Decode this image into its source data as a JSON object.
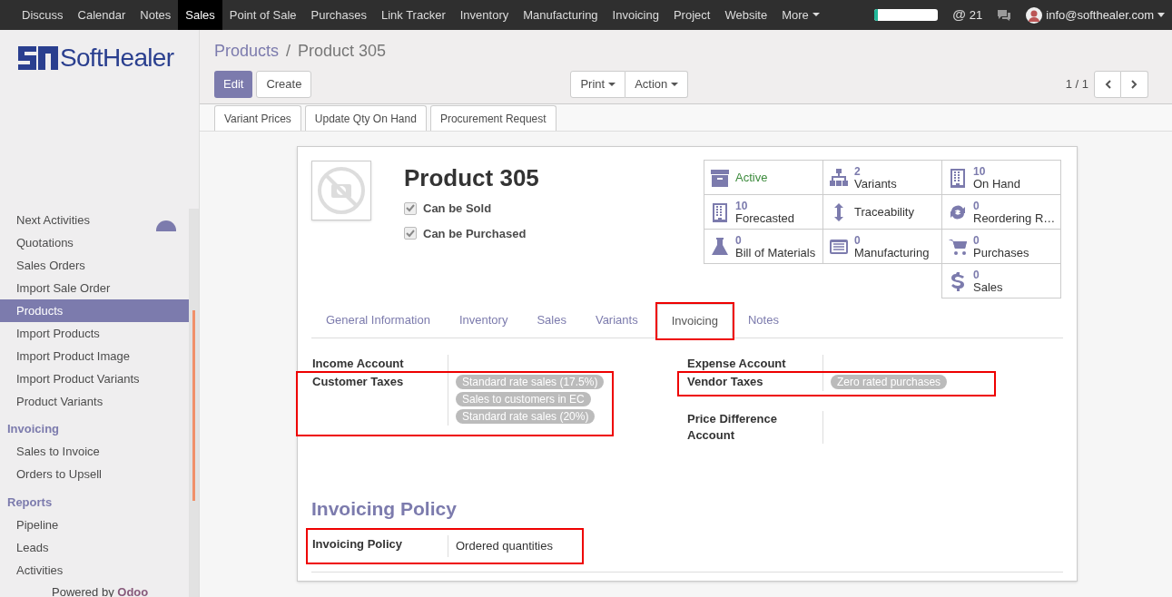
{
  "top_menu": [
    {
      "label": "Discuss",
      "selected": false
    },
    {
      "label": "Calendar",
      "selected": false
    },
    {
      "label": "Notes",
      "selected": false
    },
    {
      "label": "Sales",
      "selected": true
    },
    {
      "label": "Point of Sale",
      "selected": false
    },
    {
      "label": "Purchases",
      "selected": false
    },
    {
      "label": "Link Tracker",
      "selected": false
    },
    {
      "label": "Inventory",
      "selected": false
    },
    {
      "label": "Manufacturing",
      "selected": false
    },
    {
      "label": "Invoicing",
      "selected": false
    },
    {
      "label": "Project",
      "selected": false
    },
    {
      "label": "Website",
      "selected": false
    },
    {
      "label": "More",
      "selected": false
    }
  ],
  "systray": {
    "progress": {
      "level": 0.05
    },
    "at_sign": "@",
    "activity_count": "21",
    "user": "info@softhealer.com"
  },
  "sidebar": {
    "logo": "SoftHealer",
    "sections": [
      {
        "items": [
          {
            "label": "Next Activities",
            "selected": false
          },
          {
            "label": "Quotations",
            "selected": false
          },
          {
            "label": "Sales Orders",
            "selected": false
          },
          {
            "label": "Import Sale Order",
            "selected": false
          },
          {
            "label": "Products",
            "selected": true
          },
          {
            "label": "Import Products",
            "selected": false
          },
          {
            "label": "Import Product Image",
            "selected": false
          },
          {
            "label": "Import Product Variants",
            "selected": false
          },
          {
            "label": "Product Variants",
            "selected": false
          }
        ]
      },
      {
        "title": "Invoicing",
        "items": [
          {
            "label": "Sales to Invoice",
            "selected": false
          },
          {
            "label": "Orders to Upsell",
            "selected": false
          }
        ]
      },
      {
        "title": "Reports",
        "items": [
          {
            "label": "Pipeline",
            "selected": false
          },
          {
            "label": "Leads",
            "selected": false
          },
          {
            "label": "Activities",
            "selected": false
          }
        ]
      }
    ],
    "footer_prefix": "Powered by",
    "footer_brand": "Odoo"
  },
  "breadcrumb": {
    "parent": "Products",
    "separator": "/",
    "current": "Product 305"
  },
  "buttons": {
    "edit": "Edit",
    "create": "Create",
    "print": "Print",
    "action": "Action",
    "pager": "1 / 1"
  },
  "header_buttons": [
    "Variant Prices",
    "Update Qty On Hand",
    "Procurement Request"
  ],
  "product": {
    "name": "Product 305",
    "checkboxes": [
      {
        "label": "Can be Sold",
        "checked": true
      },
      {
        "label": "Can be Purchased",
        "checked": true
      }
    ]
  },
  "stat_buttons": [
    {
      "label": "Active"
    },
    {
      "value": "2",
      "label": "Variants"
    },
    {
      "value": "10",
      "label": "On Hand"
    },
    {
      "value": "10",
      "label": "Forecasted"
    },
    {
      "label": "Traceability"
    },
    {
      "value": "0",
      "label": "Reordering R…"
    },
    {
      "value": "0",
      "label": "Bill of Materials"
    },
    {
      "value": "0",
      "label": "Manufacturing"
    },
    {
      "value": "0",
      "label": "Purchases"
    },
    {
      "value": "0",
      "label": "Sales"
    }
  ],
  "tabs": [
    {
      "label": "General Information",
      "selected": false,
      "highlighted": false
    },
    {
      "label": "Inventory",
      "selected": false,
      "highlighted": false
    },
    {
      "label": "Sales",
      "selected": false,
      "highlighted": false
    },
    {
      "label": "Variants",
      "selected": false,
      "highlighted": false
    },
    {
      "label": "Invoicing",
      "selected": true,
      "highlighted": true
    },
    {
      "label": "Notes",
      "selected": false,
      "highlighted": false
    }
  ],
  "left_fields": [
    {
      "label": "Income Account",
      "highlighted": false
    },
    {
      "label": "Customer Taxes",
      "tags": [
        "Standard rate sales (17.5%)",
        "Sales to customers in EC",
        "Standard rate sales (20%)"
      ],
      "highlighted": true
    }
  ],
  "right_fields": [
    {
      "label": "Expense Account",
      "highlighted": false
    },
    {
      "label": "Vendor Taxes",
      "tags": [
        "Zero rated purchases"
      ],
      "highlighted": true
    },
    {
      "label": "Price Difference Account",
      "highlighted": false
    }
  ],
  "policy": {
    "title": "Invoicing Policy",
    "label": "Invoicing Policy",
    "value": "Ordered quantities",
    "highlighted": true
  }
}
